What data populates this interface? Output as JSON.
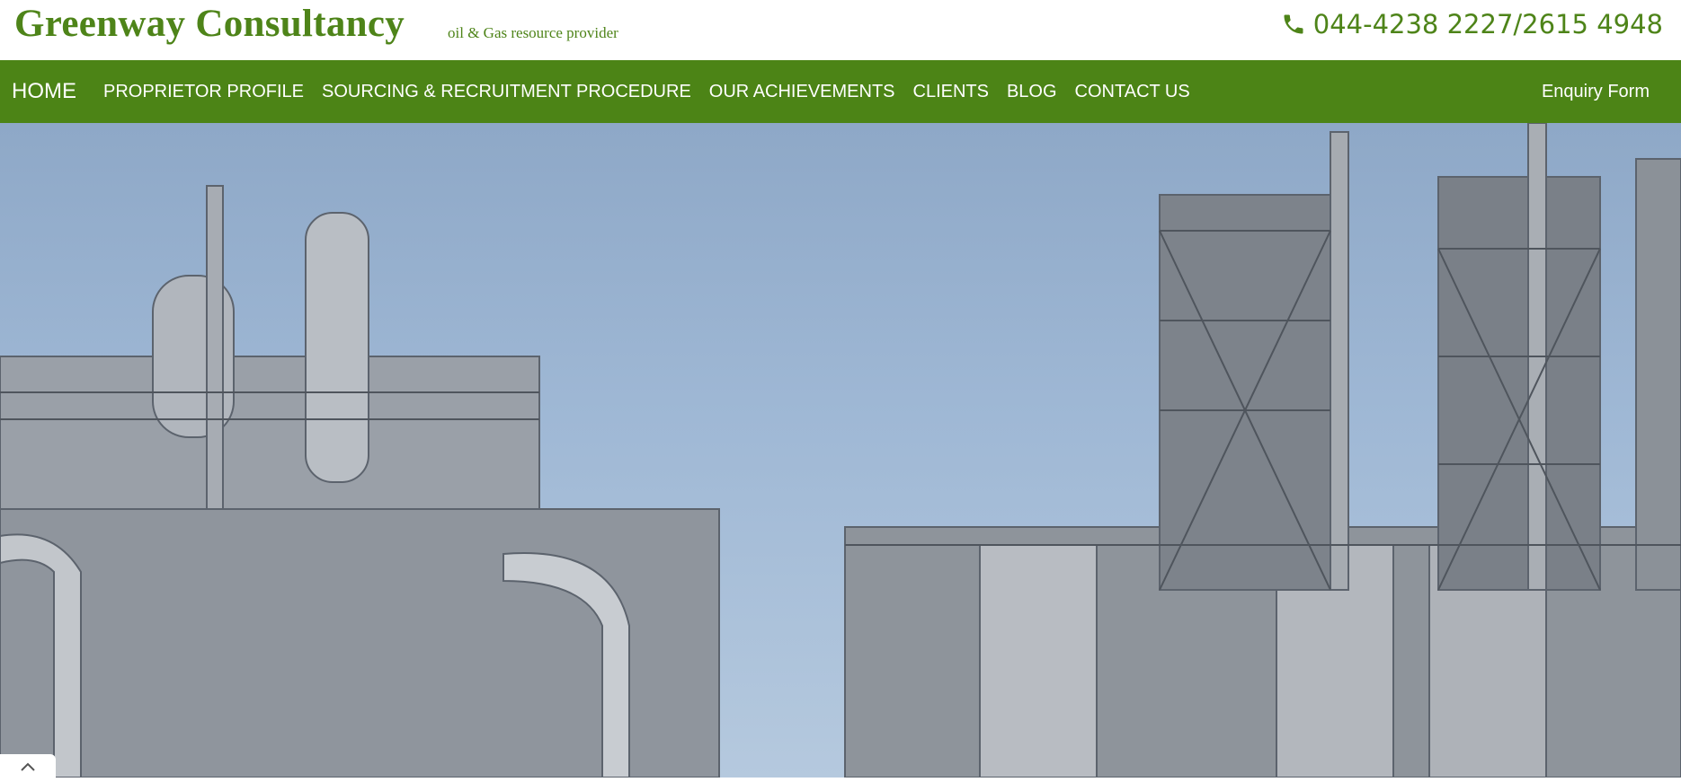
{
  "header": {
    "brand_title": "Greenway Consultancy",
    "brand_subtitle": "oil & Gas resource provider",
    "phone_icon": "phone-icon",
    "phone_text": "044-4238 2227/2615 4948"
  },
  "nav": {
    "home": "HOME",
    "items": [
      {
        "label": "PROPRIETOR PROFILE"
      },
      {
        "label": "SOURCING & RECRUITMENT PROCEDURE"
      },
      {
        "label": "OUR ACHIEVEMENTS"
      },
      {
        "label": "CLIENTS"
      },
      {
        "label": "BLOG"
      },
      {
        "label": "CONTACT US"
      }
    ],
    "enquiry": "Enquiry Form"
  },
  "hero": {
    "image": "oil-refinery-photo"
  },
  "scroll_top": {
    "icon": "chevron-up-icon"
  },
  "colors": {
    "brand_green": "#4e8419",
    "nav_green": "#4c8416",
    "nav_text": "#ffffff"
  }
}
